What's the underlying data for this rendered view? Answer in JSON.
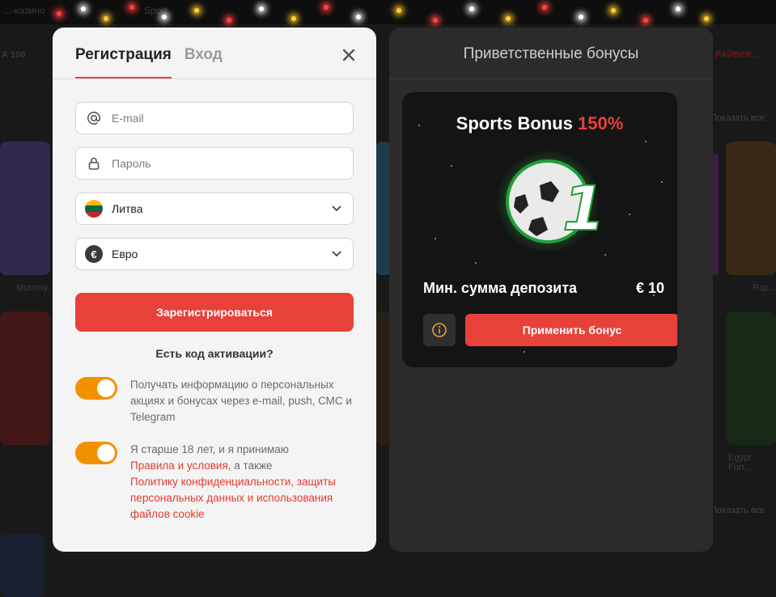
{
  "background": {
    "topbar": [
      "...-казино",
      "Sport"
    ],
    "strip_left": "А 100",
    "strip_right": "РАЙВЕР...",
    "show_all": "Показать все",
    "captions": [
      "Mummy...",
      "Rap...",
      "Egypt Fort..."
    ]
  },
  "modal": {
    "tabs": {
      "register": "Регистрация",
      "login": "Вход"
    },
    "email": {
      "placeholder": "E-mail"
    },
    "password": {
      "placeholder": "Пароль"
    },
    "country": {
      "value": "Литва"
    },
    "currency": {
      "value": "Евро",
      "symbol": "€"
    },
    "register_button": "Зарегистрироваться",
    "activation_code": "Есть код активации?",
    "option1": {
      "text": "Получать информацию о персональных акциях и бонусах через e-mail, push, СМС и Telegram",
      "enabled": true
    },
    "option2": {
      "text_before": "Я старше 18 лет, и я принимаю",
      "terms_link": "Правила и условия",
      "text_mid": ", а также",
      "privacy_link": "Политику конфиденциальности, защиты персональных данных и использования файлов cookie",
      "enabled": true
    }
  },
  "bonus_panel": {
    "title": "Приветственные бонусы",
    "card": {
      "name": "Sports Bonus",
      "percent": "150%",
      "min_deposit_label": "Мин. сумма депозита",
      "min_deposit_value": "€ 10",
      "apply_button": "Применить бонус",
      "badge_number": "1"
    }
  },
  "colors": {
    "accent": "#e8413a",
    "toggle": "#f29100",
    "flag": [
      "#fdb913",
      "#006a44",
      "#c1272d"
    ]
  }
}
